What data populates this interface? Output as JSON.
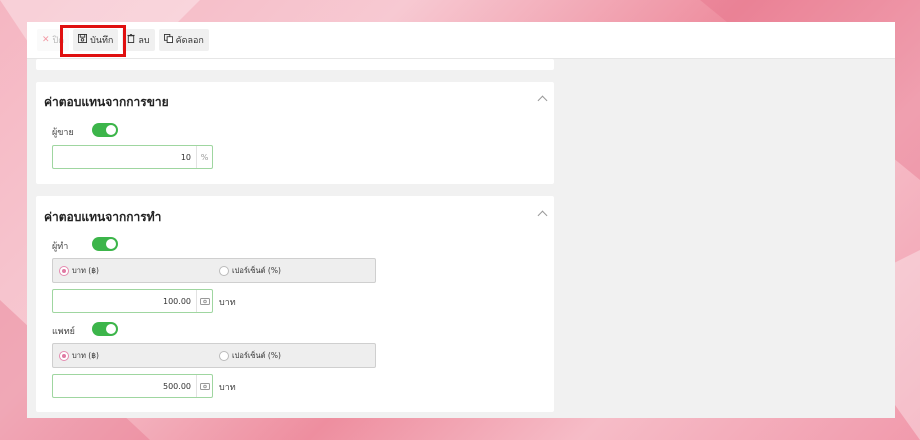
{
  "toolbar": {
    "close": {
      "label": "ปิด",
      "icon": "close-icon"
    },
    "save": {
      "label": "บันทึก",
      "icon": "save-icon"
    },
    "delete": {
      "label": "ลบ",
      "icon": "trash-icon"
    },
    "copy": {
      "label": "คัดลอก",
      "icon": "copy-icon"
    }
  },
  "sales_section": {
    "title": "ค่าตอบแทนจากการขาย",
    "seller_label": "ผู้ขาย",
    "seller_enabled": true,
    "seller_value": "10",
    "seller_suffix": "%"
  },
  "service_section": {
    "title": "ค่าตอบแทนจากการทำ",
    "doer": {
      "label": "ผู้ทำ",
      "enabled": true,
      "radio_baht": "บาท (฿)",
      "radio_percent": "เปอร์เซ็นต์ (%)",
      "selected": "baht",
      "value": "100.00",
      "unit": "บาท"
    },
    "doctor": {
      "label": "แพทย์",
      "enabled": true,
      "radio_baht": "บาท (฿)",
      "radio_percent": "เปอร์เซ็นต์ (%)",
      "selected": "baht",
      "value": "500.00",
      "unit": "บาท"
    }
  },
  "colors": {
    "toggle_on": "#3cb54a",
    "highlight": "#e01010",
    "radio_selected": "#e07aa4"
  }
}
